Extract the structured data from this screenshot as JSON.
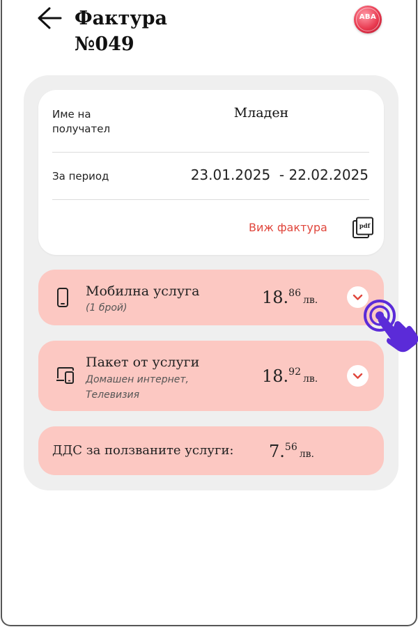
{
  "header": {
    "title_line1": "Фактура",
    "title_line2": "№049",
    "logo_text": "ABA"
  },
  "invoice": {
    "recipient_label": "Име на получател",
    "recipient_value": "Младен",
    "period_label": "За период",
    "period_value": "23.01.2025  - 22.02.2025",
    "view_invoice_label": "Виж фактура",
    "pdf_icon_text": "pdf"
  },
  "services": [
    {
      "title": "Мобилна услуга",
      "subtitle": "(1 брой)",
      "price_int": "18.",
      "price_dec": "86",
      "currency": "лв.",
      "icon": "smartphone-icon"
    },
    {
      "title": "Пакет от услуги",
      "subtitle": "Домашен интернет, Телевизия",
      "price_int": "18.",
      "price_dec": "92",
      "currency": "лв.",
      "icon": "devices-icon"
    }
  ],
  "vat": {
    "label": "ДДС за ползваните услуги:",
    "price_int": "7.",
    "price_dec": "56",
    "currency": "лв."
  },
  "colors": {
    "accent": "#e0463c",
    "card_pink": "#fcc8c2",
    "panel_gray": "#efefef",
    "tap_hand": "#5b2bd8"
  }
}
